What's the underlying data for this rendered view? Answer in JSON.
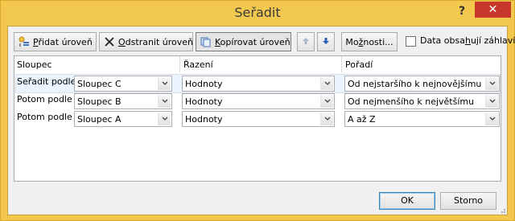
{
  "window": {
    "title": "Seřadit",
    "help_label": "?",
    "close_label": "✕"
  },
  "toolbar": {
    "add_level": {
      "pre": "",
      "underlined": "P",
      "post": "řidat úroveň"
    },
    "delete_level": {
      "pre": "",
      "underlined": "O",
      "post": "dstranit úroveň"
    },
    "copy_level": {
      "pre": "",
      "underlined": "K",
      "post": "opírovat úroveň"
    },
    "options": {
      "pre": "Mo",
      "underlined": "ž",
      "post": "nosti..."
    },
    "headers_checkbox": {
      "pre": "Data obsa",
      "underlined": "h",
      "post": "ují záhlaví",
      "checked": false
    }
  },
  "grid": {
    "headers": {
      "column": "Sloupec",
      "sort_on": "Řazení",
      "order": "Pořadí"
    },
    "rows": [
      {
        "label": "Seřadit podle",
        "column": "Sloupec C",
        "sort_on": "Hodnoty",
        "order": "Od nejstaršího k nejnovějšímu"
      },
      {
        "label": "Potom podle",
        "column": "Sloupec B",
        "sort_on": "Hodnoty",
        "order": "Od nejmenšího k největšímu"
      },
      {
        "label": "Potom podle",
        "column": "Sloupec A",
        "sort_on": "Hodnoty",
        "order": "A až Z"
      }
    ]
  },
  "footer": {
    "ok_label": "OK",
    "cancel_label": "Storno"
  }
}
